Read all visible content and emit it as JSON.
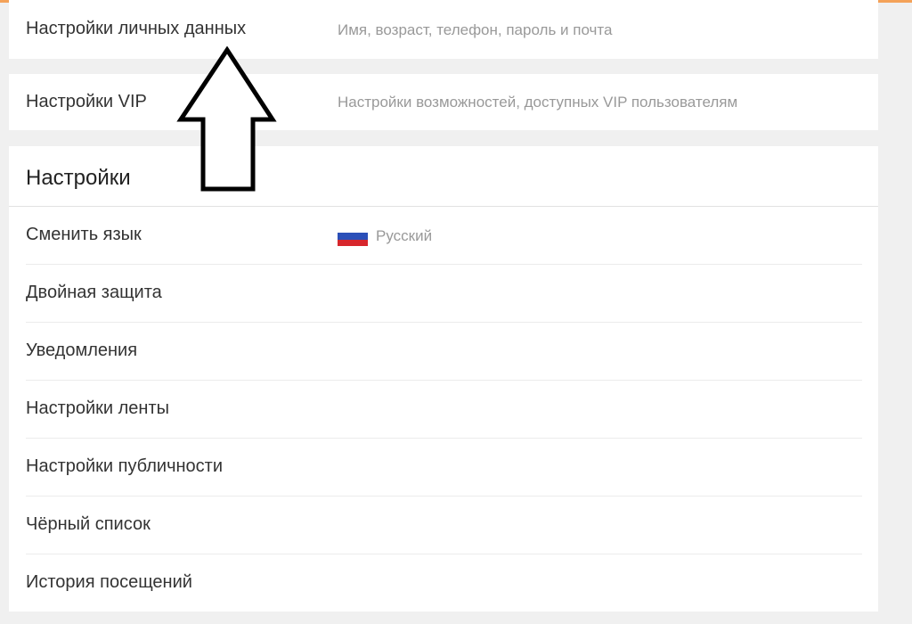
{
  "theme": {
    "accent": "#f4a259",
    "flag_colors": [
      "#ffffff",
      "#2b4fb8",
      "#d7262c"
    ]
  },
  "personal": {
    "label": "Настройки личных данных",
    "description": "Имя, возраст, телефон, пароль и почта"
  },
  "vip": {
    "label": "Настройки VIP",
    "description": "Настройки возможностей, доступных VIP пользователям"
  },
  "settings": {
    "title": "Настройки",
    "items": [
      {
        "label": "Сменить язык",
        "value": "Русский",
        "icon": "russia-flag-icon"
      },
      {
        "label": "Двойная защита"
      },
      {
        "label": "Уведомления"
      },
      {
        "label": "Настройки ленты"
      },
      {
        "label": "Настройки публичности"
      },
      {
        "label": "Чёрный список"
      },
      {
        "label": "История посещений"
      }
    ]
  },
  "annotation": {
    "icon": "up-arrow-icon"
  }
}
